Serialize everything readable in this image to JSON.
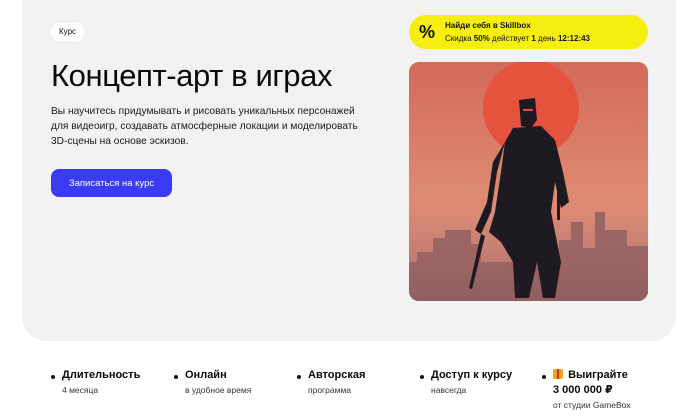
{
  "hero": {
    "badge": "Курс",
    "title": "Концепт-арт в играх",
    "description": "Вы научитесь придумывать и рисовать уникальных персонажей для видеоигр, создавать атмосферные локации и моделировать 3D-сцены на основе эскизов.",
    "cta_label": "Записаться на курс"
  },
  "promo": {
    "icon": "%",
    "line1": "Найди себя в Skillbox",
    "discount_prefix": "Скидка",
    "discount_value": "50%",
    "discount_middle": "действует",
    "days_value": "1",
    "days_word": "день",
    "timer": "12:12:43"
  },
  "features": [
    {
      "title": "Длительность",
      "subtitle": "4 месяца"
    },
    {
      "title": "Онлайн",
      "subtitle": "в удобное время"
    },
    {
      "title": "Авторская",
      "subtitle": "программа"
    },
    {
      "title": "Доступ к курсу",
      "subtitle": "навсегда"
    },
    {
      "title": "Выиграйте",
      "amount": "3 000 000 ₽",
      "subtitle": "от студии GameBox"
    }
  ],
  "colors": {
    "accent": "#3b3bf5",
    "promo_bg": "#f6ee11",
    "hero_bg": "#f2f2f2",
    "art_sky": "#d8705c",
    "art_sun": "#e8553e"
  },
  "icons": {
    "promo": "percent-icon",
    "gift": "gift-icon",
    "feature_bullet": "dot-icon"
  }
}
